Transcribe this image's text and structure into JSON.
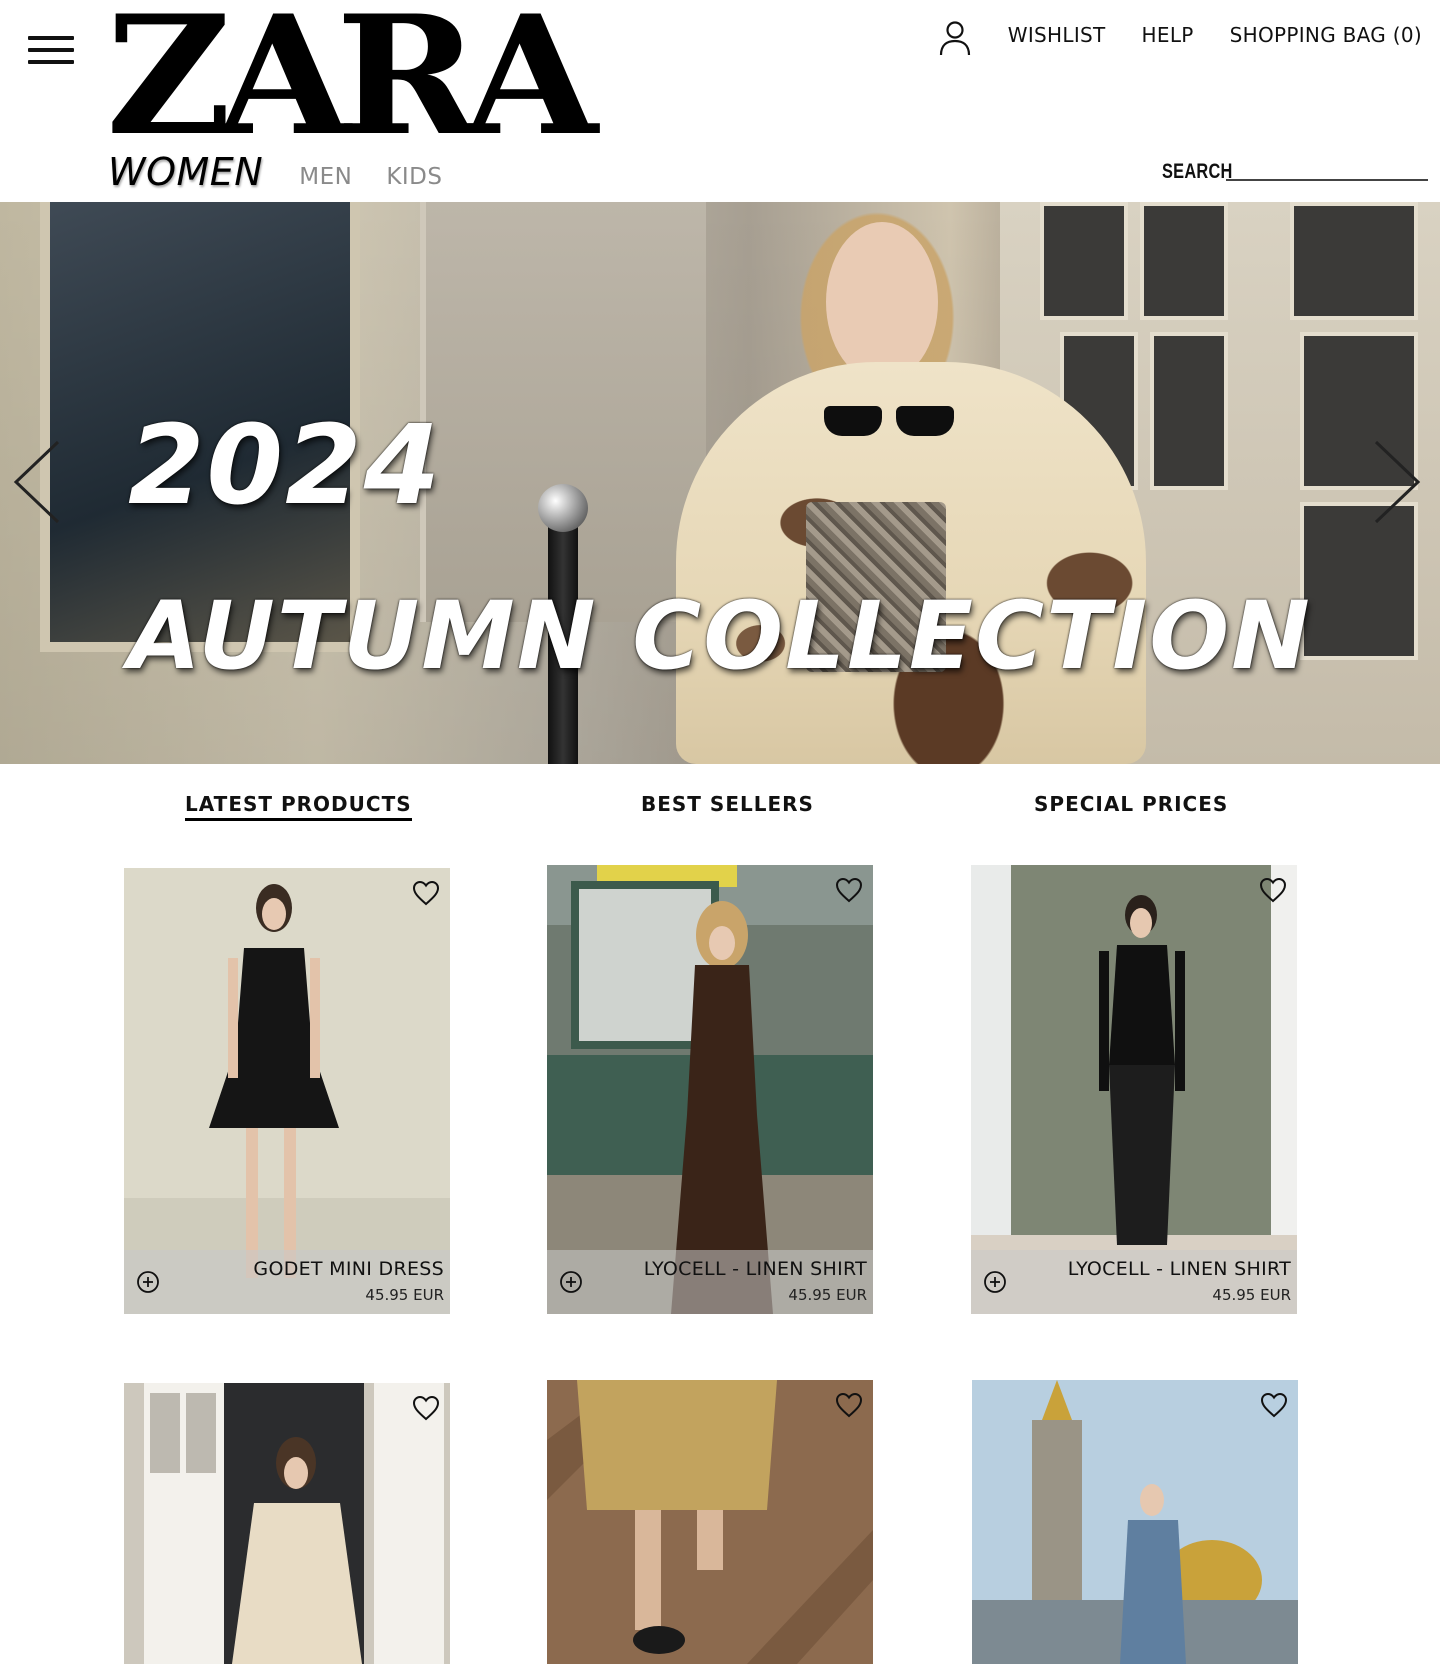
{
  "header": {
    "logo_text": "ZARA",
    "categories": {
      "women": "WOMEN",
      "men": "MEN",
      "kids": "KIDS"
    },
    "top_links": {
      "wishlist": "WISHLIST",
      "help": "HELP",
      "bag": "SHOPPING BAG (0)"
    },
    "search_label": "SEARCH"
  },
  "hero": {
    "year": "2024",
    "title": "AUTUMN COLLECTION"
  },
  "tabs": {
    "latest": "LATEST PRODUCTS",
    "best": "BEST SELLERS",
    "special": "SPECIAL PRICES"
  },
  "products": [
    {
      "name": "GODET MINI DRESS",
      "price": "45.95 EUR"
    },
    {
      "name": "LYOCELL - LINEN SHIRT",
      "price": "45.95 EUR"
    },
    {
      "name": "LYOCELL - LINEN SHIRT",
      "price": "45.95 EUR"
    }
  ],
  "icons": {
    "menu": "hamburger-menu-icon",
    "account": "user-icon",
    "prev": "chevron-left-icon",
    "next": "chevron-right-icon",
    "wishlist": "heart-icon",
    "add": "plus-circle-icon"
  }
}
